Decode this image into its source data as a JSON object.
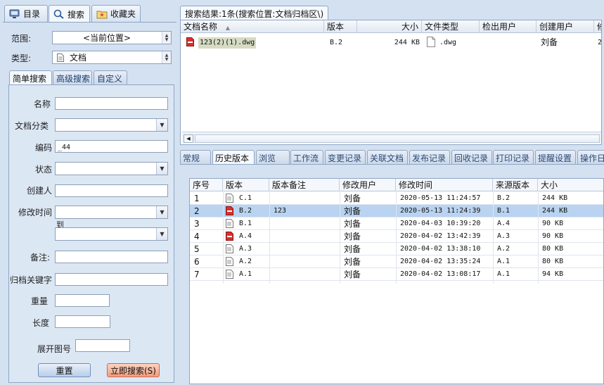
{
  "left_tabs": [
    {
      "label": "目录",
      "icon": "catalog-icon"
    },
    {
      "label": "搜索",
      "icon": "search-icon"
    },
    {
      "label": "收藏夹",
      "icon": "favorites-folder-icon"
    }
  ],
  "form": {
    "scope_label": "范围:",
    "scope_value": "<当前位置>",
    "type_label": "类型:",
    "type_value": "文档",
    "subtabs": [
      "简单搜索",
      "高级搜索",
      "自定义"
    ],
    "fields": {
      "name": "名称",
      "doc_category": "文档分类",
      "code": "编码",
      "code_value": "_44",
      "status": "状态",
      "creator": "创建人",
      "modify_time": "修改时间",
      "to": "到",
      "remark": "备注:",
      "archive_keyword": "归档关键字",
      "weight": "重量",
      "length": "长度",
      "sheet_no": "展开图号"
    },
    "reset_label": "重置",
    "search_label": "立即搜索(S)"
  },
  "results": {
    "tab_label": "搜索结果:1条(搜索位置:文档归档区\\)",
    "columns": [
      "文档名称",
      "版本",
      "大小",
      "文件类型",
      "检出用户",
      "创建用户",
      "修"
    ],
    "rows": [
      {
        "name": "123(2)(1).dwg",
        "version": "B.2",
        "size": "244 KB",
        "filetype": ".dwg",
        "checkout": "",
        "creator": "刘备",
        "extra": "2"
      }
    ]
  },
  "detail_tabs": [
    "常规",
    "历史版本",
    "浏览",
    "工作流",
    "变更记录",
    "关联文档",
    "发布记录",
    "回收记录",
    "打印记录",
    "提醒设置",
    "操作日"
  ],
  "history": {
    "columns": [
      "序号",
      "版本",
      "版本备注",
      "修改用户",
      "修改时间",
      "来源版本",
      "大小"
    ],
    "rows": [
      {
        "no": "1",
        "version": "C.1",
        "note": "",
        "user": "刘备",
        "time": "2020-05-13 11:24:57",
        "source": "B.2",
        "size": "244 KB",
        "icon": "plain"
      },
      {
        "no": "2",
        "version": "B.2",
        "note": "123",
        "user": "刘备",
        "time": "2020-05-13 11:24:39",
        "source": "B.1",
        "size": "244 KB",
        "icon": "red"
      },
      {
        "no": "3",
        "version": "B.1",
        "note": "",
        "user": "刘备",
        "time": "2020-04-03 10:39:20",
        "source": "A.4",
        "size": "90 KB",
        "icon": "plain"
      },
      {
        "no": "4",
        "version": "A.4",
        "note": "",
        "user": "刘备",
        "time": "2020-04-02 13:42:39",
        "source": "A.3",
        "size": "90 KB",
        "icon": "red"
      },
      {
        "no": "5",
        "version": "A.3",
        "note": "",
        "user": "刘备",
        "time": "2020-04-02 13:38:10",
        "source": "A.2",
        "size": "80 KB",
        "icon": "plain"
      },
      {
        "no": "6",
        "version": "A.2",
        "note": "",
        "user": "刘备",
        "time": "2020-04-02 13:35:24",
        "source": "A.1",
        "size": "80 KB",
        "icon": "plain"
      },
      {
        "no": "7",
        "version": "A.1",
        "note": "",
        "user": "刘备",
        "time": "2020-04-02 13:08:17",
        "source": "A.1",
        "size": "94 KB",
        "icon": "plain"
      }
    ],
    "selected_row": 2
  },
  "colors": {
    "background": "#d4e1f1",
    "selected_row": "#b9d3f0",
    "dwg_red": "#d9302c",
    "search_button": "#f7b49a"
  }
}
